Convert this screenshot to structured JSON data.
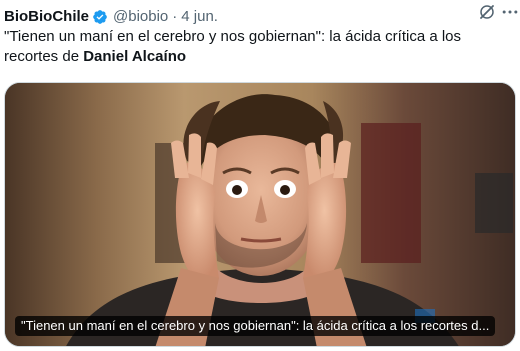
{
  "author": {
    "name": "BioBioChile",
    "verified_icon": "verified-badge-icon",
    "handle": "@biobio",
    "separator": "·",
    "date": "4 jun."
  },
  "header_actions": {
    "grok_icon": "grok-icon",
    "more_icon": "more-options-icon"
  },
  "tweet": {
    "text_before": "\"Tienen un maní en el cerebro y nos gobiernan\": la ácida crítica a los recortes de ",
    "text_bold": "Daniel Alcaíno"
  },
  "card": {
    "caption": "\"Tienen un maní en el cerebro y nos gobiernan\": la ácida crítica a los recortes d..."
  },
  "colors": {
    "text_primary": "#0f1419",
    "text_secondary": "#536471",
    "verified_blue": "#1d9bf0",
    "border": "#cfd9de"
  }
}
